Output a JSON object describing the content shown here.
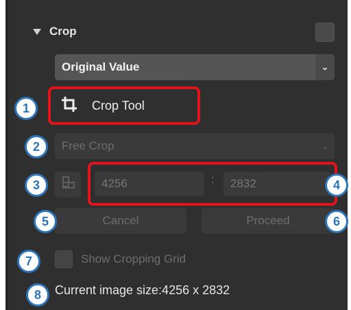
{
  "section": {
    "title": "Crop"
  },
  "preset_select": {
    "value": "Original Value"
  },
  "crop_tool": {
    "label": "Crop Tool"
  },
  "aspect_select": {
    "value": "Free Crop"
  },
  "dimensions": {
    "width": "4256",
    "separator": ":",
    "height": "2832"
  },
  "buttons": {
    "cancel": "Cancel",
    "proceed": "Proceed"
  },
  "grid": {
    "label": "Show Cropping Grid"
  },
  "status": {
    "current_size": "Current image size:4256 x 2832"
  },
  "callouts": [
    "1",
    "2",
    "3",
    "4",
    "5",
    "6",
    "7",
    "8"
  ],
  "colors": {
    "highlight": "#e1141c",
    "callout": "#2d74b8",
    "panel": "#2f2f2f"
  }
}
